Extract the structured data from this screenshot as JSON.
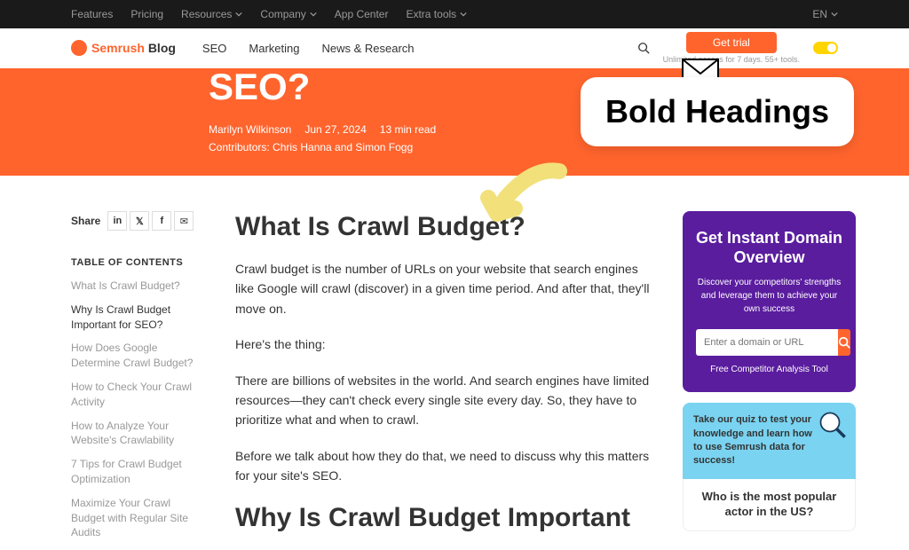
{
  "topnav": {
    "items": [
      "Features",
      "Pricing",
      "Resources",
      "Company",
      "App Center",
      "Extra tools"
    ],
    "lang": "EN"
  },
  "subnav": {
    "logo_a": "Semrush",
    "logo_b": "Blog",
    "links": [
      "SEO",
      "Marketing",
      "News & Research"
    ],
    "trial": "Get trial",
    "trial_sub": "Unlimited access for 7 days. 55+ tools."
  },
  "hero": {
    "title": "SEO?",
    "author": "Marilyn Wilkinson",
    "date": "Jun 27, 2024",
    "read": "13 min read",
    "contrib": "Contributors: Chris Hanna and Simon Fogg",
    "callout": "Bold Headings"
  },
  "share": {
    "label": "Share"
  },
  "toc": {
    "title": "TABLE OF CONTENTS",
    "items": [
      {
        "label": "What Is Crawl Budget?",
        "active": false
      },
      {
        "label": "Why Is Crawl Budget Important for SEO?",
        "active": true
      },
      {
        "label": "How Does Google Determine Crawl Budget?",
        "active": false
      },
      {
        "label": "How to Check Your Crawl Activity",
        "active": false
      },
      {
        "label": "How to Analyze Your Website's Crawlability",
        "active": false
      },
      {
        "label": "7 Tips for Crawl Budget Optimization",
        "active": false
      },
      {
        "label": "Maximize Your Crawl Budget with Regular Site Audits",
        "active": false
      }
    ]
  },
  "article": {
    "h1": "What Is Crawl Budget?",
    "p1": "Crawl budget is the number of URLs on your website that search engines like Google will crawl (discover) in a given time period. And after that, they'll move on.",
    "p2": "Here's the thing:",
    "p3": "There are billions of websites in the world. And search engines have limited resources—they can't check every single site every day. So, they have to prioritize what and when to crawl.",
    "p4": "Before we talk about how they do that, we need to discuss why this matters for your site's SEO.",
    "h2": "Why Is Crawl Budget Important"
  },
  "widget": {
    "title": "Get Instant Domain Overview",
    "desc": "Discover your competitors' strengths and leverage them to achieve your own success",
    "placeholder": "Enter a domain or URL",
    "link": "Free Competitor Analysis Tool"
  },
  "quiz": {
    "prompt": "Take our quiz to test your knowledge and learn how to use Semrush data for success!",
    "question": "Who is the most popular actor in the US?"
  }
}
